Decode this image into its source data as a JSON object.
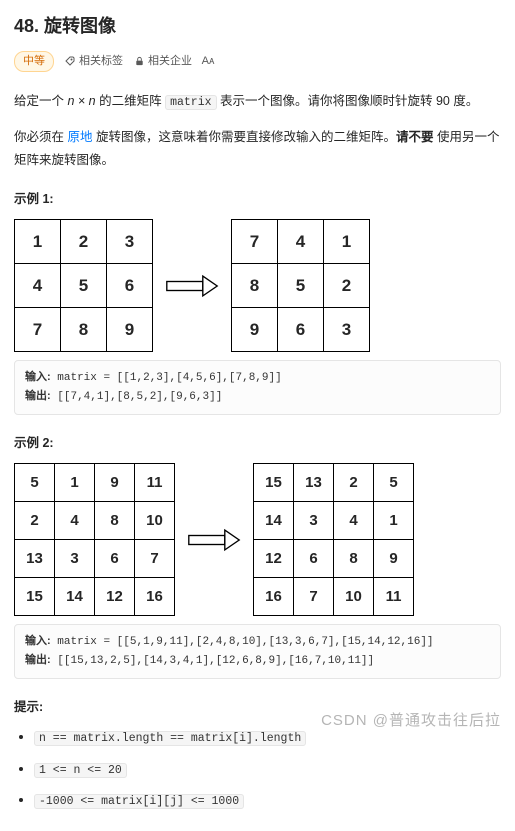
{
  "title": "48. 旋转图像",
  "difficulty": "中等",
  "meta": {
    "tags_label": "相关标签",
    "companies_label": "相关企业"
  },
  "description": {
    "p1_a": "给定一个 ",
    "p1_n": "n × n",
    "p1_b": " 的二维矩阵 ",
    "p1_matrix": "matrix",
    "p1_c": " 表示一个图像。请你将图像顺时针旋转 90 度。",
    "p2_a": "你必须在 ",
    "p2_kw": "原地",
    "p2_b": " 旋转图像，这意味着你需要直接修改输入的二维矩阵。",
    "p2_c": "请不要",
    "p2_d": " 使用另一个矩阵来旋转图像。"
  },
  "examples": [
    {
      "label": "示例 1:",
      "size": 3,
      "chart_data": {
        "type": "table",
        "input_matrix": [
          [
            1,
            2,
            3
          ],
          [
            4,
            5,
            6
          ],
          [
            7,
            8,
            9
          ]
        ],
        "output_matrix": [
          [
            7,
            4,
            1
          ],
          [
            8,
            5,
            2
          ],
          [
            9,
            6,
            3
          ]
        ]
      },
      "io": {
        "input_label": "输入:",
        "input_text": "matrix = [[1,2,3],[4,5,6],[7,8,9]]",
        "output_label": "输出:",
        "output_text": "[[7,4,1],[8,5,2],[9,6,3]]"
      }
    },
    {
      "label": "示例 2:",
      "size": 4,
      "chart_data": {
        "type": "table",
        "input_matrix": [
          [
            5,
            1,
            9,
            11
          ],
          [
            2,
            4,
            8,
            10
          ],
          [
            13,
            3,
            6,
            7
          ],
          [
            15,
            14,
            12,
            16
          ]
        ],
        "output_matrix": [
          [
            15,
            13,
            2,
            5
          ],
          [
            14,
            3,
            4,
            1
          ],
          [
            12,
            6,
            8,
            9
          ],
          [
            16,
            7,
            10,
            11
          ]
        ]
      },
      "io": {
        "input_label": "输入:",
        "input_text": "matrix = [[5,1,9,11],[2,4,8,10],[13,3,6,7],[15,14,12,16]]",
        "output_label": "输出:",
        "output_text": "[[15,13,2,5],[14,3,4,1],[12,6,8,9],[16,7,10,11]]"
      }
    }
  ],
  "constraints_label": "提示:",
  "constraints": [
    "n == matrix.length == matrix[i].length",
    "1 <= n <= 20",
    "-1000 <= matrix[i][j] <= 1000"
  ],
  "watermark": "CSDN @普通攻击往后拉"
}
